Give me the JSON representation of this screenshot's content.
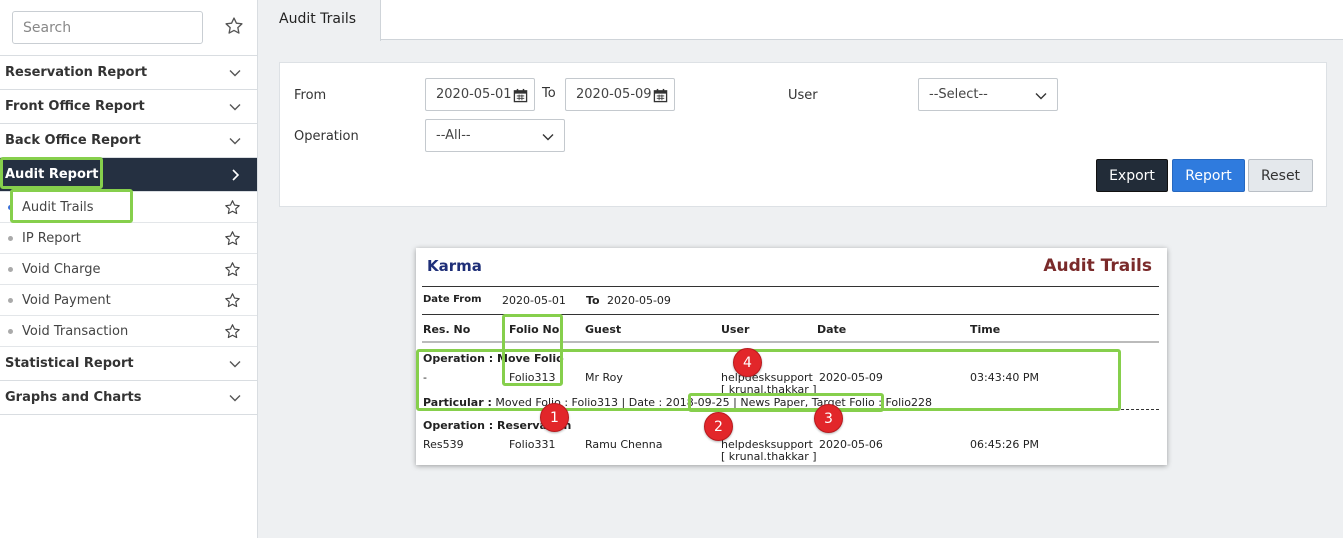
{
  "sidebar": {
    "search_placeholder": "Search",
    "menus_top": [
      {
        "label": "Reservation Report"
      },
      {
        "label": "Front Office Report"
      },
      {
        "label": "Back Office Report"
      },
      {
        "label": "Audit Report"
      }
    ],
    "sub_items": [
      {
        "label": "Audit Trails"
      },
      {
        "label": "IP Report"
      },
      {
        "label": "Void Charge"
      },
      {
        "label": "Void Payment"
      },
      {
        "label": "Void Transaction"
      }
    ],
    "menus_bottom": [
      {
        "label": "Statistical Report"
      },
      {
        "label": "Graphs and Charts"
      }
    ]
  },
  "tab": {
    "label": "Audit Trails"
  },
  "filters": {
    "from_label": "From",
    "from_value": "2020-05-01",
    "to_label": "To",
    "to_value": "2020-05-09",
    "user_label": "User",
    "user_value": "--Select--",
    "operation_label": "Operation",
    "operation_value": "--All--"
  },
  "buttons": {
    "export": "Export",
    "report": "Report",
    "reset": "Reset"
  },
  "report": {
    "company": "Karma",
    "title": "Audit Trails",
    "date_from_label": "Date From",
    "date_from": "2020-05-01",
    "to_label": "To",
    "date_to": "2020-05-09",
    "columns": [
      "Res. No",
      "Folio No",
      "Guest",
      "User",
      "Date",
      "Time"
    ],
    "op1": {
      "label": "Operation : Move Folio",
      "res_no": "-",
      "folio": "Folio313",
      "guest": "Mr Roy",
      "user": "helpdesksupport",
      "user_sub": "[ krunal.thakkar ]",
      "date": "2020-05-09",
      "time": "03:43:40 PM",
      "particular_label": "Particular :",
      "particular_text": "Moved Folio : Folio313 | Date : 2018-09-25 | News Paper, Target Folio : Folio228"
    },
    "op2": {
      "label": "Operation : Reservation",
      "res_no": "Res539",
      "folio": "Folio331",
      "guest": "Ramu Chenna",
      "user": "helpdesksupport",
      "user_sub": "[ krunal.thakkar ]",
      "date": "2020-05-06",
      "time": "06:45:26 PM"
    }
  },
  "badges": [
    "1",
    "2",
    "3",
    "4"
  ],
  "colors": {
    "accent": "#2f7bde",
    "dark": "#253041",
    "highlight": "#86cf4c",
    "badge": "#e2262a"
  }
}
